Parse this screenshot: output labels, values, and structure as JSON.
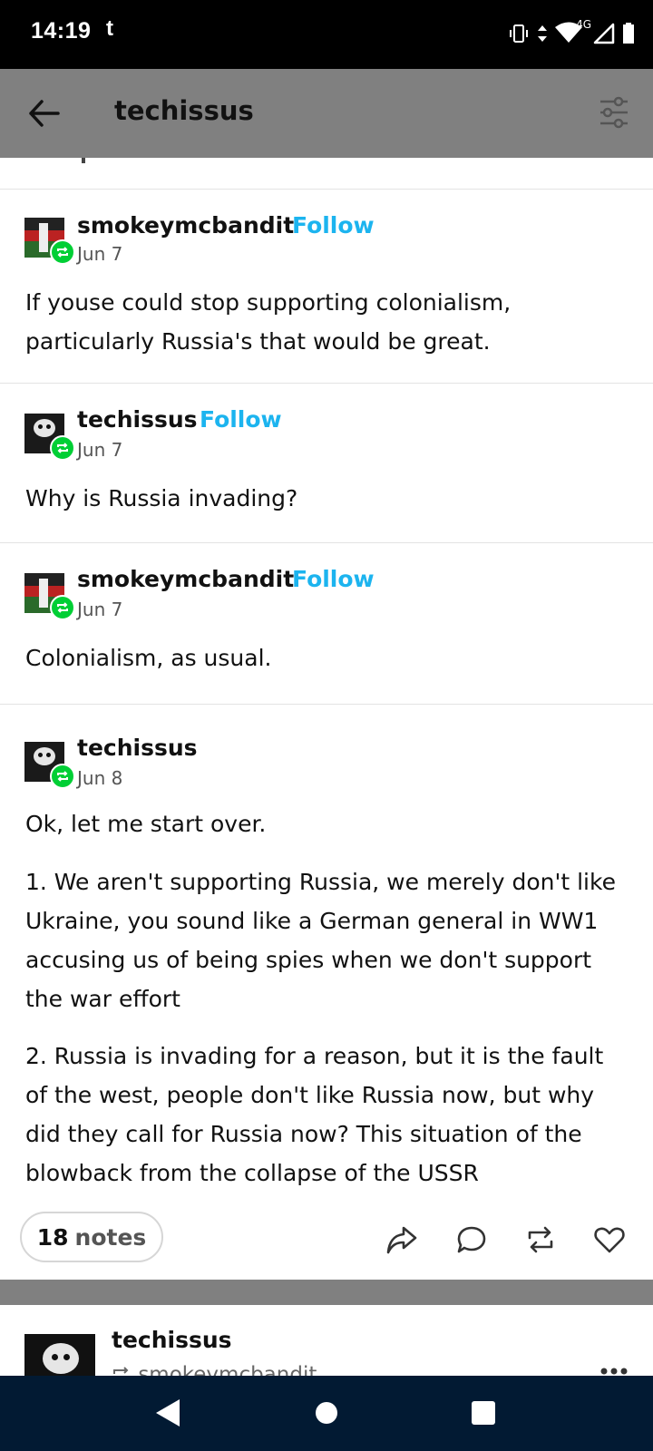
{
  "status_bar": {
    "time": "14:19",
    "notification_glyph": "t",
    "icons": [
      "vibrate-icon",
      "data-arrows-icon",
      "wifi-icon",
      "signal-icon",
      "battery-icon"
    ],
    "network_label": "4G"
  },
  "app_bar": {
    "title": "techissus",
    "back_icon": "back-arrow-icon",
    "filter_icon": "filter-settings-icon"
  },
  "thread": [
    {
      "username": "smokeymcbandit",
      "follow_label": "Follow",
      "date": "Jun 7",
      "avatar": "flag-avatar",
      "paragraphs": [
        "If youse could stop supporting colonialism, particularly Russia's that would be great."
      ]
    },
    {
      "username": "techissus",
      "follow_label": "Follow",
      "date": "Jun 7",
      "avatar": "skull-avatar",
      "paragraphs": [
        "Why is Russia invading?"
      ]
    },
    {
      "username": "smokeymcbandit",
      "follow_label": "Follow",
      "date": "Jun 7",
      "avatar": "flag-avatar",
      "paragraphs": [
        "Colonialism, as usual."
      ]
    },
    {
      "username": "techissus",
      "date": "Jun 8",
      "avatar": "skull-avatar",
      "paragraphs": [
        "Ok, let me start over.",
        "1. We aren't supporting Russia, we merely don't like Ukraine, you sound like a German general in WW1 accusing us of being spies when we don't support the war effort",
        "2. Russia is invading for a reason, but it is the fault of the west, people don't like Russia now, but why did they call for Russia now? This situation of the blowback from the collapse of the USSR"
      ]
    }
  ],
  "footer": {
    "notes_count": "18",
    "notes_label": "notes",
    "actions": [
      "share-icon",
      "reply-icon",
      "reblog-icon",
      "like-icon"
    ]
  },
  "next_post": {
    "username": "techissus",
    "reblogged_from": "smokeymcbandit",
    "more_icon": "more-options-icon"
  },
  "nav_bar": {
    "icons": [
      "nav-back-icon",
      "nav-home-icon",
      "nav-recents-icon"
    ]
  },
  "colors": {
    "accent_follow": "#1cb4ef",
    "reblog_badge": "#00cf35",
    "app_bar_bg": "#808080",
    "nav_bar_bg": "#021a33"
  }
}
